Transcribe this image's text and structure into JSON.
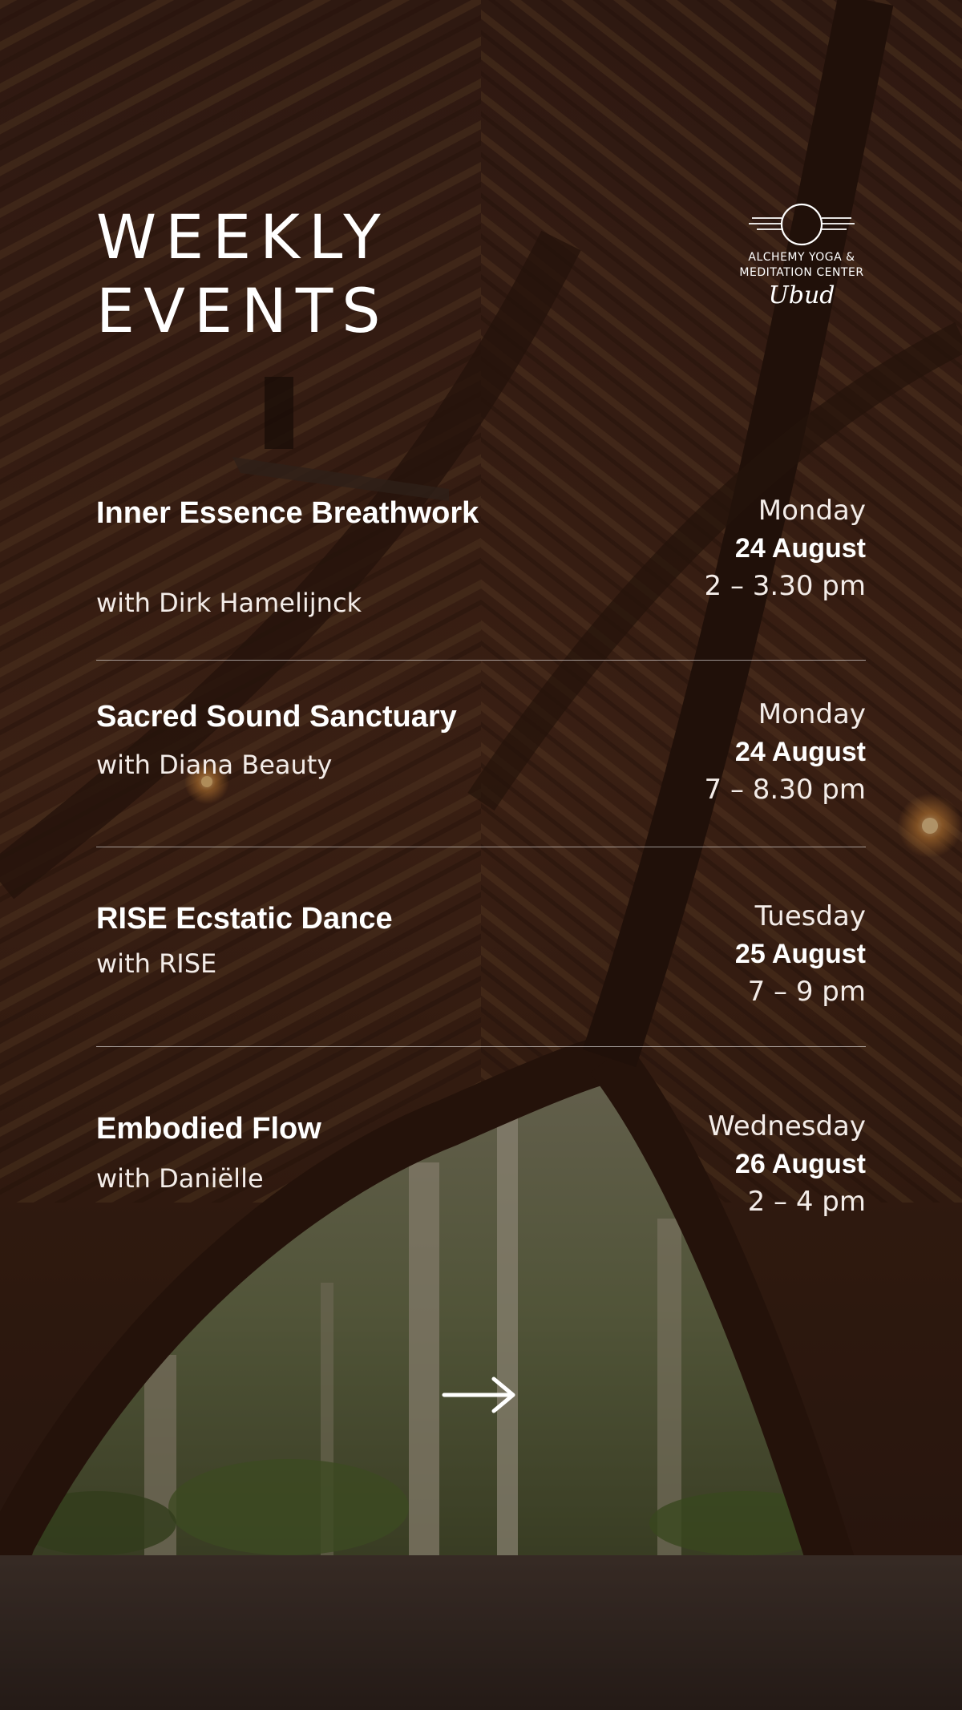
{
  "title": {
    "line1": "WEEKLY",
    "line2": "EVENTS"
  },
  "logo": {
    "line1": "ALCHEMY YOGA &",
    "line2": "MEDITATION CENTER",
    "script": "Ubud",
    "icon": "sun-horizon-logo-icon"
  },
  "events": [
    {
      "name": "Inner Essence Breathwork",
      "host": "with Dirk Hamelijnck",
      "day": "Monday",
      "date": "24 August",
      "time": "2 – 3.30 pm"
    },
    {
      "name": "Sacred Sound Sanctuary",
      "host": "with Diana Beauty",
      "day": "Monday",
      "date": "24 August",
      "time": "7 – 8.30 pm"
    },
    {
      "name": "RISE Ecstatic Dance",
      "host": "with RISE",
      "day": "Tuesday",
      "date": "25 August",
      "time": "7 – 9 pm"
    },
    {
      "name": "Embodied Flow",
      "host": "with Daniëlle",
      "day": "Wednesday",
      "date": "26 August",
      "time": "2 – 4 pm"
    }
  ],
  "next": {
    "icon": "arrow-right-icon"
  }
}
